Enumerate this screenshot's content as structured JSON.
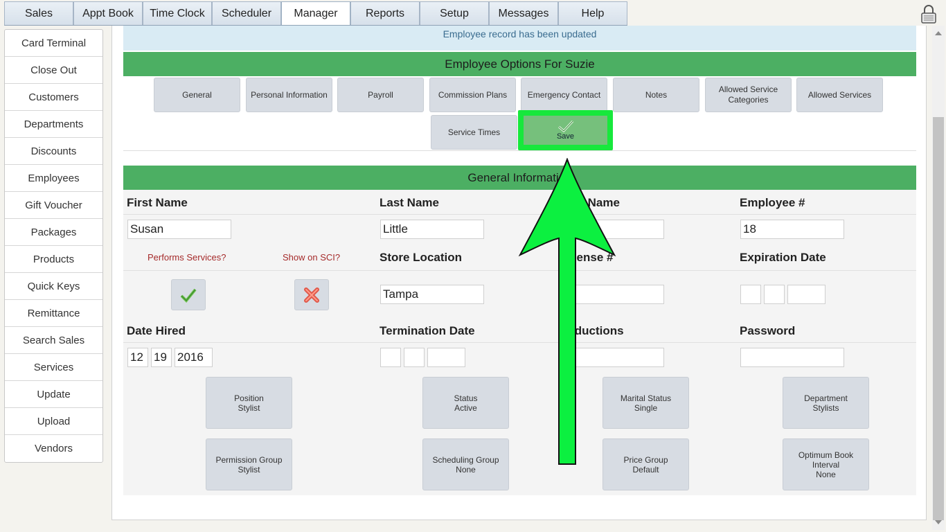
{
  "tabs": [
    {
      "label": "Sales"
    },
    {
      "label": "Appt Book"
    },
    {
      "label": "Time Clock"
    },
    {
      "label": "Scheduler"
    },
    {
      "label": "Manager"
    },
    {
      "label": "Reports"
    },
    {
      "label": "Setup"
    },
    {
      "label": "Messages"
    },
    {
      "label": "Help"
    }
  ],
  "active_tab": "Manager",
  "sidebar": {
    "items": [
      {
        "label": "Card Terminal"
      },
      {
        "label": "Close Out"
      },
      {
        "label": "Customers"
      },
      {
        "label": "Departments"
      },
      {
        "label": "Discounts"
      },
      {
        "label": "Employees"
      },
      {
        "label": "Gift Voucher"
      },
      {
        "label": "Packages"
      },
      {
        "label": "Products"
      },
      {
        "label": "Quick Keys"
      },
      {
        "label": "Remittance"
      },
      {
        "label": "Search Sales"
      },
      {
        "label": "Services"
      },
      {
        "label": "Update"
      },
      {
        "label": "Upload"
      },
      {
        "label": "Vendors"
      }
    ]
  },
  "notice": "Employee record has been updated",
  "options_header": "Employee Options For Suzie",
  "options": [
    {
      "label": "General"
    },
    {
      "label": "Personal Information"
    },
    {
      "label": "Payroll"
    },
    {
      "label": "Commission Plans"
    },
    {
      "label": "Emergency Contact"
    },
    {
      "label": "Notes"
    },
    {
      "label": "Allowed Service Categories"
    },
    {
      "label": "Allowed Services"
    },
    {
      "label": "Service Times"
    }
  ],
  "save_label": "Save",
  "general_header": "General Information",
  "fields": {
    "first_name_label": "First Name",
    "first_name": "Susan",
    "last_name_label": "Last Name",
    "last_name": "Little",
    "nick_name_label": "Nick Name",
    "employee_no_label": "Employee #",
    "employee_no": "18",
    "performs_services": "Performs Services?",
    "show_on_sci": "Show on SCI?",
    "store_location_label": "Store Location",
    "store_location": "Tampa",
    "license_label": "License #",
    "expiration_label": "Expiration Date",
    "date_hired_label": "Date Hired",
    "date_hired": {
      "month": "12",
      "day": "19",
      "year": "2016"
    },
    "termination_label": "Termination Date",
    "deductions_label": "Deductions",
    "password_label": "Password"
  },
  "detail_buttons": [
    {
      "title": "Position",
      "value": "Stylist"
    },
    {
      "title": "Status",
      "value": "Active"
    },
    {
      "title": "Marital Status",
      "value": "Single"
    },
    {
      "title": "Department",
      "value": "Stylists"
    },
    {
      "title": "Permission Group",
      "value": "Stylist"
    },
    {
      "title": "Scheduling Group",
      "value": "None"
    },
    {
      "title": "Price Group",
      "value": "Default"
    },
    {
      "title": "Optimum Book Interval",
      "value": "None"
    }
  ],
  "colors": {
    "header_green": "#4caf63",
    "save_highlight": "#17e83c",
    "arrow": "#0cf040"
  }
}
